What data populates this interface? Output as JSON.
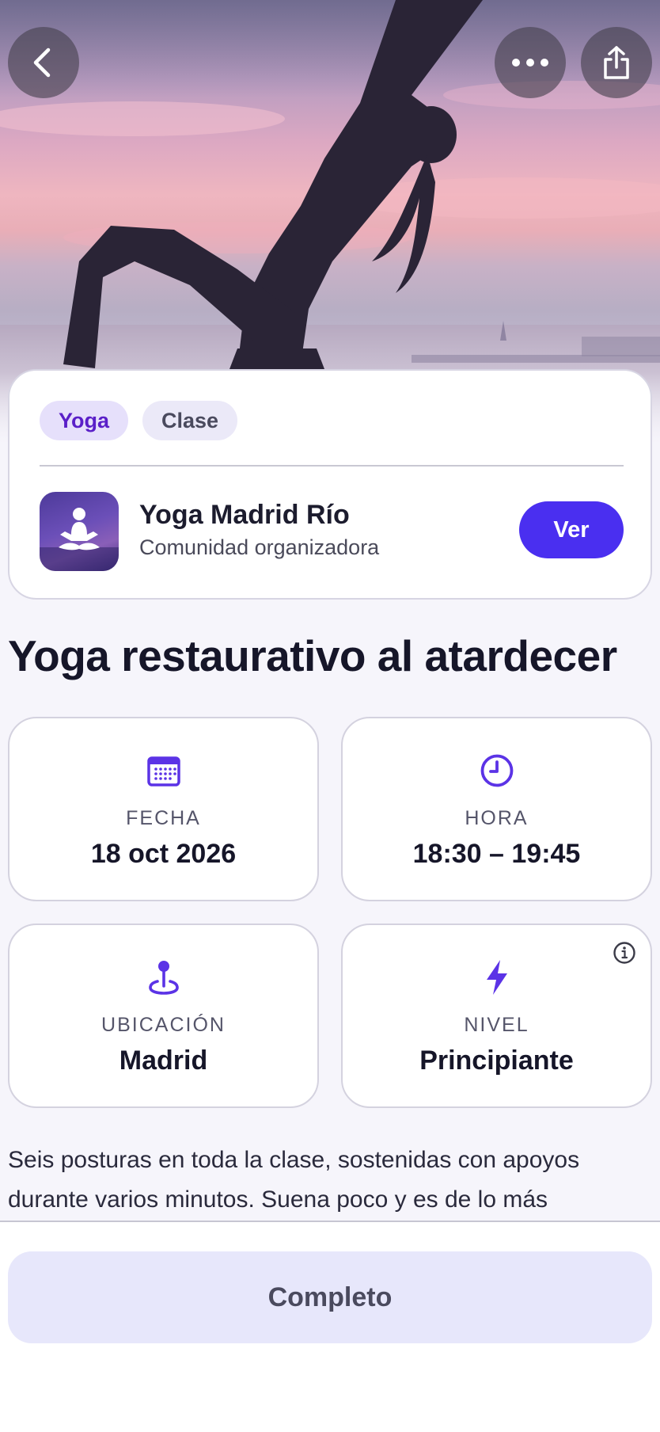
{
  "hero": {
    "image": "yoga-sunset-silhouette"
  },
  "toolbar": {
    "back_icon": "chevron-left-icon",
    "more_icon": "ellipsis-icon",
    "share_icon": "share-icon"
  },
  "tags": [
    "Yoga",
    "Clase"
  ],
  "organizer": {
    "name": "Yoga Madrid Río",
    "subtitle": "Comunidad organizadora",
    "button_label": "Ver"
  },
  "event": {
    "title": "Yoga restaurativo al atardecer",
    "description": "Seis posturas en toda la clase, sostenidas con apoyos durante varios minutos. Suena poco y es de lo más"
  },
  "info": [
    {
      "icon": "calendar-icon",
      "label": "FECHA",
      "value": "18 oct 2026"
    },
    {
      "icon": "clock-icon",
      "label": "HORA",
      "value": "18:30 – 19:45"
    },
    {
      "icon": "location-pin-icon",
      "label": "UBICACIÓN",
      "value": "Madrid"
    },
    {
      "icon": "lightning-icon",
      "label": "NIVEL",
      "value": "Principiante",
      "badge": "info-icon"
    }
  ],
  "action": {
    "label": "Completo"
  },
  "colors": {
    "accent": "#4a2ff0",
    "tag_yoga_text": "#5a1fc8",
    "icon_purple": "#5b33e6",
    "complete_button_bg": "#e7e7fb"
  }
}
